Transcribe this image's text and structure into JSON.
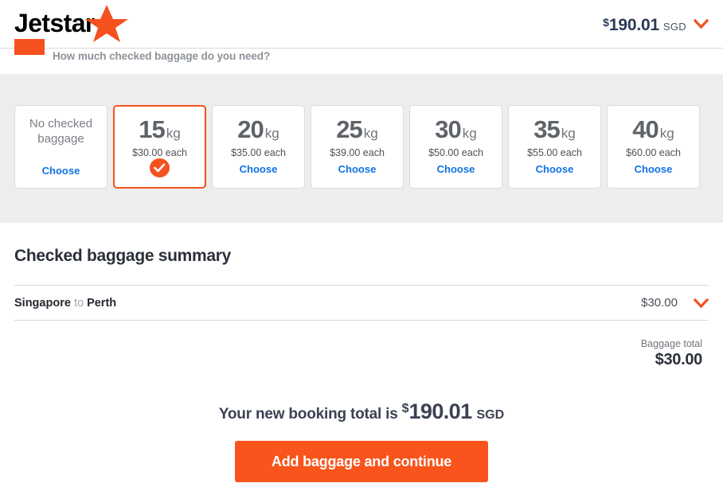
{
  "header": {
    "logo_text": "Jetstar",
    "logo_star_icon": "star-icon",
    "price_currency_symbol": "$",
    "price_amount": "190.01",
    "price_currency_code": "SGD",
    "chevron_icon": "chevron-down-icon",
    "accent_color": "#f4511e",
    "price_color": "#2b3a55"
  },
  "question": {
    "text": "How much checked baggage do you need?",
    "icon": "baggage-step-icon"
  },
  "options": {
    "choose_label": "Choose",
    "unit": "kg",
    "selected_index": 1,
    "items": [
      {
        "label": "No checked baggage",
        "weight": "",
        "price": "",
        "action": "Choose",
        "selected": false
      },
      {
        "label": "",
        "weight": "15",
        "price": "$30.00 each",
        "action": "Choose",
        "selected": true
      },
      {
        "label": "",
        "weight": "20",
        "price": "$35.00 each",
        "action": "Choose",
        "selected": false
      },
      {
        "label": "",
        "weight": "25",
        "price": "$39.00 each",
        "action": "Choose",
        "selected": false
      },
      {
        "label": "",
        "weight": "30",
        "price": "$50.00 each",
        "action": "Choose",
        "selected": false
      },
      {
        "label": "",
        "weight": "35",
        "price": "$55.00 each",
        "action": "Choose",
        "selected": false
      },
      {
        "label": "",
        "weight": "40",
        "price": "$60.00 each",
        "action": "Choose",
        "selected": false
      }
    ]
  },
  "summary": {
    "title": "Checked baggage summary",
    "route": {
      "origin": "Singapore",
      "connector": "to",
      "destination": "Perth",
      "amount": "$30.00",
      "chevron_icon": "chevron-down-icon"
    },
    "baggage_total_label": "Baggage total",
    "baggage_total_amount": "$30.00"
  },
  "footer": {
    "booking_total_lead": "Your new booking total is",
    "booking_total_currency_symbol": "$",
    "booking_total_amount": "190.01",
    "booking_total_currency_code": "SGD",
    "cta_label": "Add baggage and continue",
    "cta_color": "#f9541c"
  }
}
